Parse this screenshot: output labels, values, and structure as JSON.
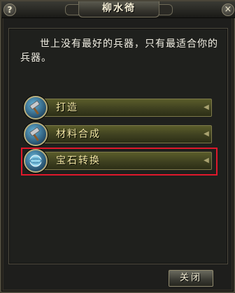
{
  "window": {
    "title": "柳水徛",
    "help_label": "?",
    "close_label": "×"
  },
  "description": "世上没有最好的兵器，只有最适合你的兵器。",
  "options": [
    {
      "label": "打造",
      "icon": "hammer-icon"
    },
    {
      "label": "材料合成",
      "icon": "hammer-icon"
    },
    {
      "label": "宝石转换",
      "icon": "gem-orb-icon",
      "highlighted": true
    }
  ],
  "footer": {
    "close_button_label": "关闭"
  },
  "colors": {
    "highlight": "#e0182b",
    "option_text": "#f5e9a6",
    "body_text": "#f2efe4"
  }
}
